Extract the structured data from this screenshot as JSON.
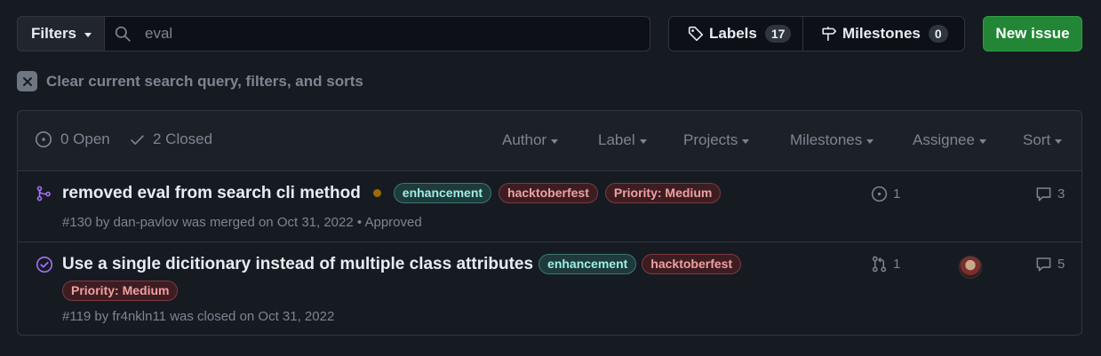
{
  "toolbar": {
    "filters_label": "Filters",
    "search_value": "eval",
    "labels_label": "Labels",
    "labels_count": "17",
    "milestones_label": "Milestones",
    "milestones_count": "0",
    "new_issue_label": "New issue"
  },
  "clear_filters": {
    "text": "Clear current search query, filters, and sorts"
  },
  "list_header": {
    "open_label": "0 Open",
    "closed_label": "2 Closed",
    "filters": [
      "Author",
      "Label",
      "Projects",
      "Milestones",
      "Assignee",
      "Sort"
    ]
  },
  "issues": [
    {
      "title": "removed eval from search cli method",
      "labels": [
        "enhancement",
        "hacktoberfest",
        "Priority: Medium"
      ],
      "meta": "#130 by dan-pavlov was merged on Oct 31, 2022",
      "review": "• Approved",
      "linked_count": "1",
      "comments": "3",
      "status_icon": "git-merge-icon",
      "status_color": "#a371f7"
    },
    {
      "title": "Use a single dicitionary instead of multiple class attributes",
      "labels": [
        "enhancement",
        "hacktoberfest",
        "Priority: Medium"
      ],
      "meta": "#119 by fr4nkln11 was closed on Oct 31, 2022",
      "linked_count": "1",
      "comments": "5",
      "status_icon": "check-circle-icon",
      "status_color": "#a371f7"
    }
  ],
  "colors": {
    "background": "#161b22",
    "header": "#1c2128",
    "primary_button": "#238636",
    "muted_text": "#7d8590"
  }
}
